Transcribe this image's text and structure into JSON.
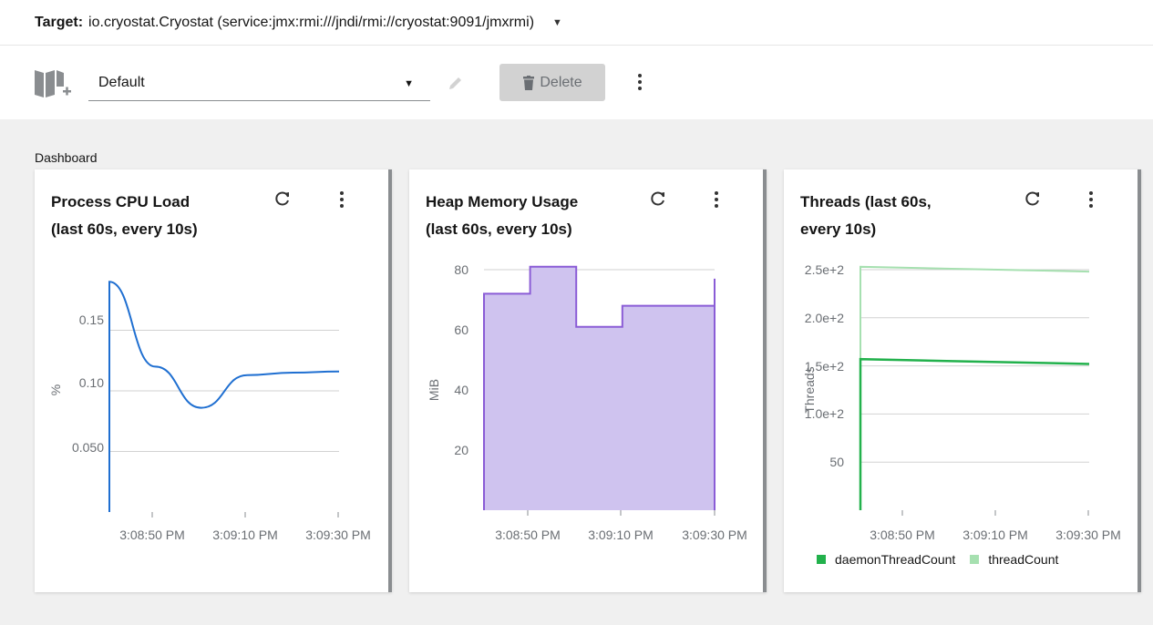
{
  "target": {
    "label": "Target:",
    "value": "io.cryostat.Cryostat (service:jmx:rmi:///jndi/rmi://cryostat:9091/jmxrmi)"
  },
  "toolbar": {
    "layout_selected": "Default",
    "delete_label": "Delete"
  },
  "dashboard": {
    "title": "Dashboard",
    "cards": [
      {
        "title_line1": "Process CPU Load",
        "title_line2": "(last 60s, every 10s)",
        "ylabel": "%",
        "yticks": [
          "0.15",
          "0.10",
          "0.050"
        ],
        "xticks": [
          "3:08:50 PM",
          "3:09:10 PM",
          "3:09:30 PM"
        ]
      },
      {
        "title_line1": "Heap Memory Usage",
        "title_line2": "(last 60s, every 10s)",
        "ylabel": "MiB",
        "yticks": [
          "80",
          "60",
          "40",
          "20"
        ],
        "xticks": [
          "3:08:50 PM",
          "3:09:10 PM",
          "3:09:30 PM"
        ]
      },
      {
        "title_line1": "Threads (last 60s,",
        "title_line2": "every 10s)",
        "ylabel": "Threads",
        "yticks": [
          "2.5e+2",
          "2.0e+2",
          "1.5e+2",
          "1.0e+2",
          "50"
        ],
        "xticks": [
          "3:08:50 PM",
          "3:09:10 PM",
          "3:09:30 PM"
        ],
        "legend": [
          "daemonThreadCount",
          "threadCount"
        ]
      }
    ]
  },
  "colors": {
    "cpu": "#1f6fd1",
    "heap_line": "#8a5cd6",
    "heap_fill": "#cfc3ef",
    "daemon": "#22b14c",
    "thread": "#a6e0b0"
  },
  "chart_data": [
    {
      "type": "line",
      "title": "Process CPU Load",
      "ylabel": "%",
      "ylim": [
        0,
        0.2
      ],
      "x": [
        "3:08:40 PM",
        "3:08:50 PM",
        "3:09:00 PM",
        "3:09:10 PM",
        "3:09:20 PM",
        "3:09:30 PM"
      ],
      "series": [
        {
          "values": [
            0.19,
            0.12,
            0.086,
            0.113,
            0.115,
            0.116
          ]
        }
      ]
    },
    {
      "type": "area",
      "title": "Heap Memory Usage",
      "ylabel": "MiB",
      "ylim": [
        0,
        80
      ],
      "x": [
        "3:08:40 PM",
        "3:08:50 PM",
        "3:09:00 PM",
        "3:09:10 PM",
        "3:09:20 PM",
        "3:09:30 PM"
      ],
      "series": [
        {
          "values": [
            72,
            81,
            61,
            68,
            68,
            77
          ]
        }
      ]
    },
    {
      "type": "line",
      "title": "Threads",
      "ylabel": "Threads",
      "ylim": [
        0,
        250
      ],
      "x": [
        "3:08:40 PM",
        "3:08:50 PM",
        "3:09:00 PM",
        "3:09:10 PM",
        "3:09:20 PM",
        "3:09:30 PM"
      ],
      "series": [
        {
          "name": "daemonThreadCount",
          "values": [
            157,
            156,
            155,
            154,
            153,
            152
          ]
        },
        {
          "name": "threadCount",
          "values": [
            253,
            252,
            251,
            250,
            249,
            248
          ]
        }
      ]
    }
  ]
}
